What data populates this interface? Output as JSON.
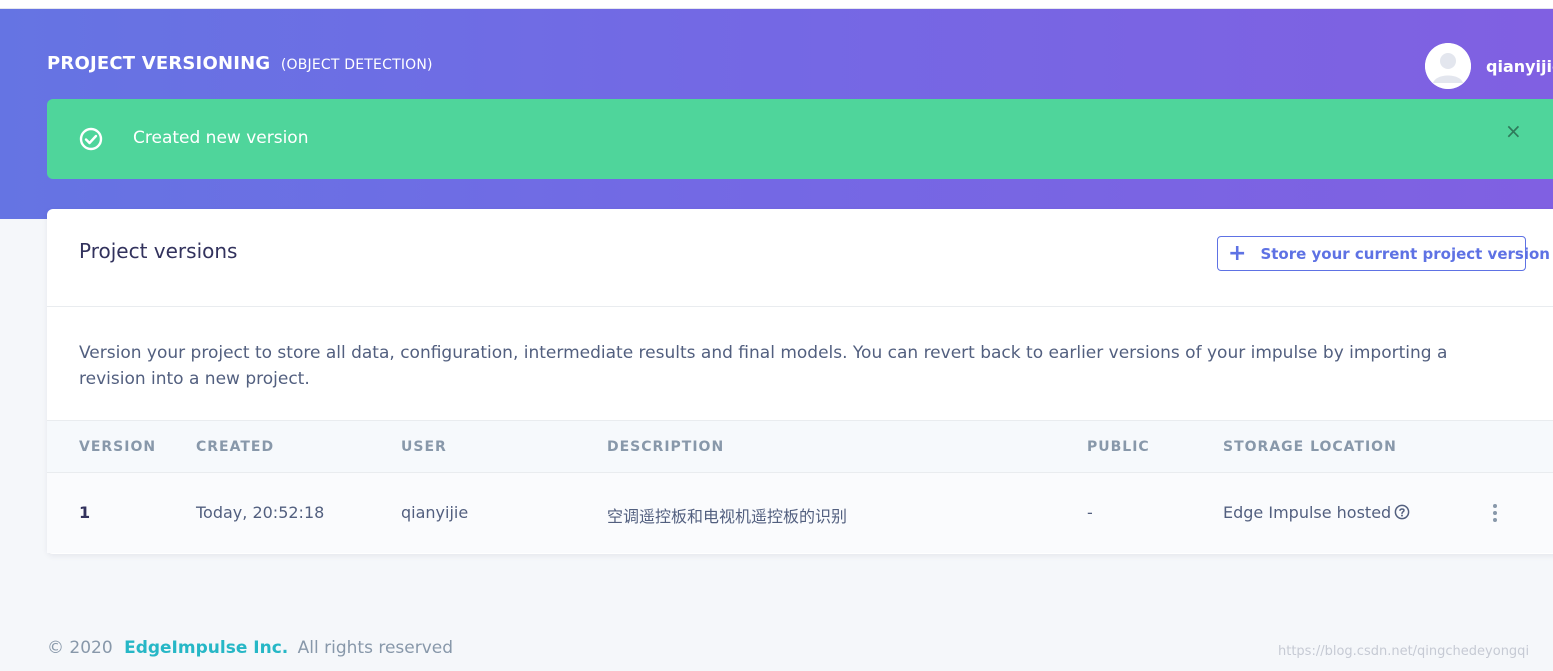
{
  "header": {
    "title": "PROJECT VERSIONING",
    "subtitle": "(OBJECT DETECTION)",
    "username": "qianyijie"
  },
  "alert": {
    "message": "Created new version",
    "icon": "check-circle-icon",
    "close_label": "×"
  },
  "card": {
    "title": "Project versions",
    "store_button": "Store your current project version",
    "description": "Version your project to store all data, configuration, intermediate results and final models. You can revert back to earlier versions of your impulse by importing a revision into a new project."
  },
  "table": {
    "columns": [
      "VERSION",
      "CREATED",
      "USER",
      "DESCRIPTION",
      "PUBLIC",
      "STORAGE LOCATION"
    ],
    "rows": [
      {
        "version": "1",
        "created": "Today, 20:52:18",
        "user": "qianyijie",
        "description": "空调遥控板和电视机遥控板的识别",
        "public": "-",
        "storage": "Edge Impulse hosted"
      }
    ]
  },
  "footer": {
    "copyright": "© 2020",
    "company": "EdgeImpulse Inc.",
    "rights": "All rights reserved"
  },
  "watermark": "https://blog.csdn.net/qingchedeyongqi",
  "colors": {
    "accent": "#5e72e4",
    "success": "#4fd59b",
    "brand": "#26b7c6"
  }
}
